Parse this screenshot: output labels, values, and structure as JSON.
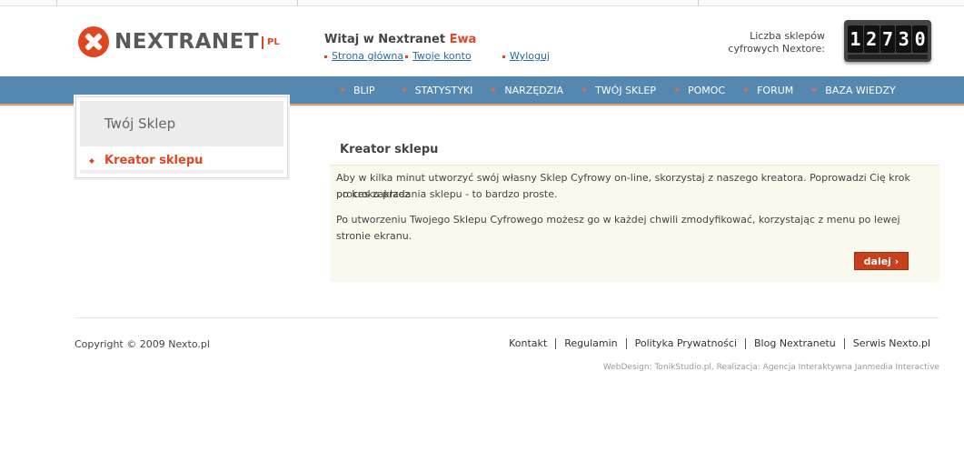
{
  "header": {
    "logo_text": "NEXTRANET",
    "logo_suffix": "PL",
    "greeting": "Witaj w Nextranet ",
    "username": "Ewa",
    "links": {
      "home": "Strona główna",
      "account": "Twoje konto",
      "logout": "Wyloguj"
    },
    "counter_label_line1": "Liczba sklepów",
    "counter_label_line2": "cyfrowych  Nextore:",
    "counter_digits": [
      "1",
      "2",
      "7",
      "3",
      "0"
    ]
  },
  "nav": {
    "items": [
      {
        "label": "BLIP"
      },
      {
        "label": "STATYSTYKI"
      },
      {
        "label": "NARZĘDZIA"
      },
      {
        "label": "TWÓJ SKLEP"
      },
      {
        "label": "POMOC"
      },
      {
        "label": "FORUM"
      },
      {
        "label": "BAZA WIEDZY"
      }
    ]
  },
  "sidebar": {
    "title": "Twój Sklep",
    "items": [
      {
        "label": "Kreator sklepu"
      }
    ]
  },
  "main": {
    "title": "Kreator sklepu",
    "paragraph1_line1": "Aby w kilka minut utworzyć swój własny Sklep Cyfrowy on-line, skorzystaj z naszego kreatora. Poprowadzi Cię krok po kroku przez",
    "paragraph1_line2": "proces zakładania sklepu - to bardzo proste.",
    "paragraph2": "Po utworzeniu Twojego Sklepu Cyfrowego możesz go w każdej chwili zmodyfikować, korzystając z menu po lewej stronie ekranu.",
    "next_button": "dalej ›"
  },
  "footer": {
    "copyright": "Copyright © 2009 Nexto.pl",
    "links": [
      {
        "label": "Kontakt"
      },
      {
        "label": "Regulamin"
      },
      {
        "label": "Polityka Prywatności"
      },
      {
        "label": "Blog Nextranetu"
      },
      {
        "label": "Serwis Nexto.pl"
      }
    ],
    "credits": "WebDesign: TonikStudio.pl, Realizacja: Agencja Interaktywna Janmedia Interactive"
  },
  "colors": {
    "accent": "#e0461f",
    "nav_bg": "#5588b0",
    "panel_bg": "#fbf9ee",
    "button": "#c8401c"
  }
}
